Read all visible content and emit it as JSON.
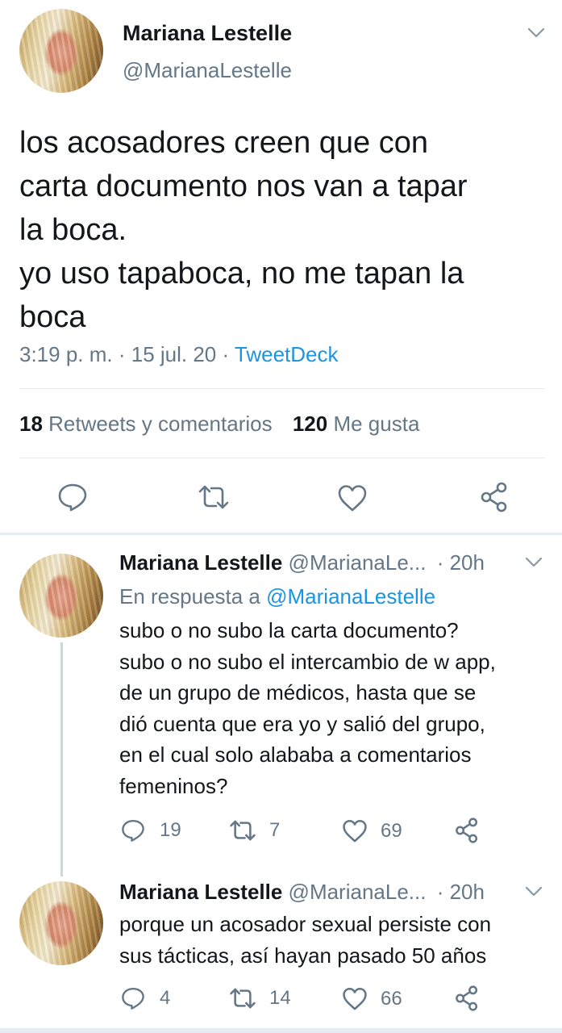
{
  "main_tweet": {
    "author_name": "Mariana Lestelle",
    "handle": "@MarianaLestelle",
    "text_lines": [
      "los acosadores creen que con",
      "carta documento nos van a tapar",
      "la boca.",
      "yo uso tapaboca, no me tapan la",
      "boca"
    ],
    "time": "3:19 p. m.",
    "sep1": " · ",
    "date": "15 jul. 20",
    "sep2": " · ",
    "source": "TweetDeck",
    "retweets_count": "18",
    "retweets_label": "Retweets y comentarios",
    "likes_count": "120",
    "likes_label": "Me gusta"
  },
  "replies": [
    {
      "author_name": "Mariana Lestelle",
      "handle": "@MarianaLe...",
      "time": "· 20h",
      "reply_prefix": "En respuesta a",
      "reply_to": "@MarianaLestelle",
      "text_lines": [
        "subo o no subo la carta documento?",
        "subo o no subo el intercambio de w app,",
        "de un grupo de médicos, hasta que se",
        "dió cuenta que era yo y salió del grupo,",
        "en el cual solo alababa a comentarios",
        "femeninos?"
      ],
      "replies": "19",
      "retweets": "7",
      "likes": "69"
    },
    {
      "author_name": "Mariana Lestelle",
      "handle": "@MarianaLe...",
      "time": "· 20h",
      "text_lines": [
        "porque un acosador sexual persiste con",
        "sus tácticas, así hayan pasado 50 años"
      ],
      "replies": "4",
      "retweets": "14",
      "likes": "66"
    }
  ],
  "colors": {
    "text": "#14171a",
    "muted": "#657786",
    "link": "#1b95e0",
    "divider": "#e6ecf0"
  },
  "icons": [
    "chevron-down-icon",
    "reply-icon",
    "retweet-icon",
    "like-icon",
    "share-icon"
  ]
}
